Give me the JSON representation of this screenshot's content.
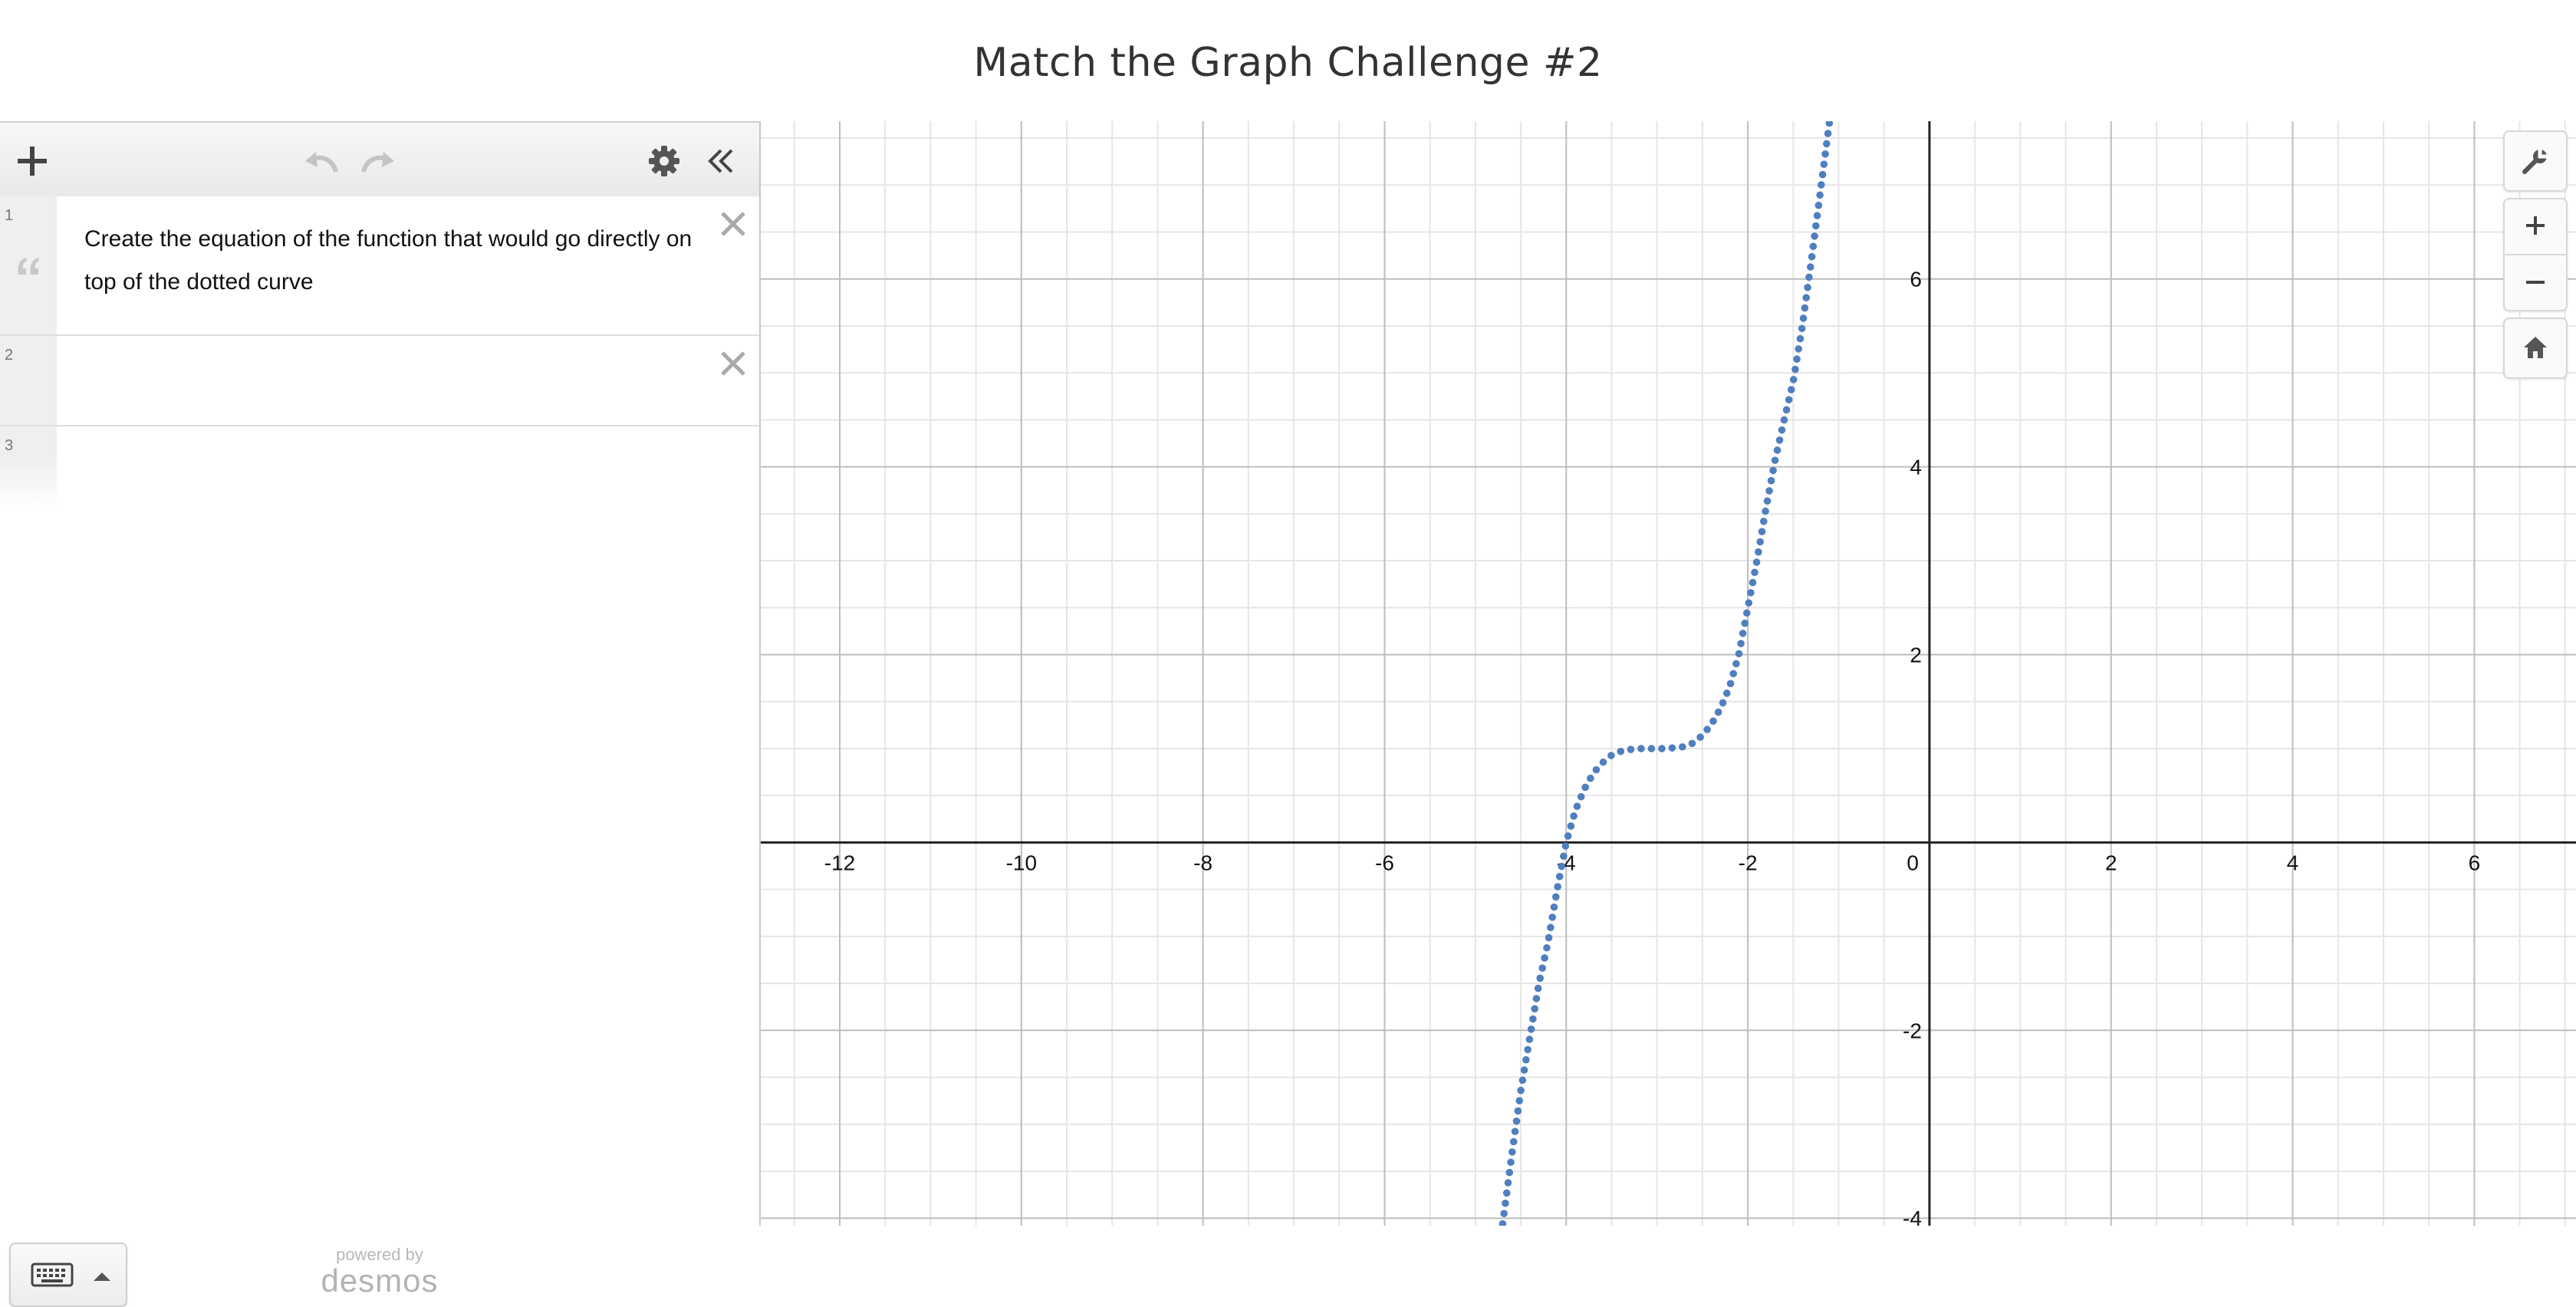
{
  "page": {
    "title": "Match the Graph Challenge #2"
  },
  "expressions": [
    {
      "index": "1",
      "type": "note",
      "text": "Create the equation of the function that would go directly on top of the dotted curve"
    },
    {
      "index": "2",
      "type": "expression",
      "text": ""
    },
    {
      "index": "3",
      "type": "expression",
      "text": ""
    }
  ],
  "toolbar": {
    "icons": [
      "plus-icon",
      "undo-icon",
      "redo-icon",
      "gear-icon",
      "collapse-panel-icon"
    ]
  },
  "footer": {
    "powered_by": "powered by",
    "brand": "desmos"
  },
  "graph_controls": [
    "wrench-icon",
    "zoom-in-icon",
    "zoom-out-icon",
    "home-icon"
  ],
  "chart_data": {
    "type": "scatter",
    "title": "",
    "xlabel": "",
    "ylabel": "",
    "xlim": [
      -12.87,
      7.12
    ],
    "ylim": [
      -4.08,
      7.68
    ],
    "x_ticks": [
      -12,
      -10,
      -8,
      -6,
      -4,
      -2,
      0,
      2,
      4,
      6
    ],
    "y_ticks": [
      -4,
      -2,
      2,
      4,
      6
    ],
    "x_tick_labels": [
      "-12",
      "-10",
      "-8",
      "-6",
      "-4",
      "-2",
      "0",
      "2",
      "4",
      "6"
    ],
    "y_tick_labels": [
      "-4",
      "-2",
      "2",
      "4",
      "6"
    ],
    "grid": true,
    "series": [
      {
        "style": "dotted",
        "color": "#4f7fbf",
        "x": [
          -4.7,
          -4.6,
          -4.5,
          -4.4,
          -4.3,
          -4.2,
          -4.1,
          -4.0,
          -3.9,
          -3.8,
          -3.7,
          -3.6,
          -3.5,
          -3.4,
          -3.3,
          -3.2,
          -3.1,
          -3.0,
          -2.9,
          -2.8,
          -2.7,
          -2.6,
          -2.5,
          -2.4,
          -2.3,
          -2.2,
          -2.1,
          -2.0,
          -1.9,
          -1.8,
          -1.7,
          -1.6,
          -1.5,
          -1.4,
          -1.3,
          -1.2,
          -1.1
        ],
        "y": [
          -4.06,
          -3.33,
          -2.64,
          -2.07,
          -1.5,
          -1.06,
          -0.5,
          0.0,
          0.34,
          0.57,
          0.74,
          0.85,
          0.93,
          0.97,
          0.99,
          1.0,
          1.0,
          1.0,
          1.0,
          1.01,
          1.02,
          1.06,
          1.14,
          1.26,
          1.43,
          1.66,
          2.0,
          2.5,
          3.0,
          3.56,
          4.07,
          4.5,
          4.91,
          5.5,
          6.2,
          6.94,
          7.68
        ]
      }
    ]
  }
}
